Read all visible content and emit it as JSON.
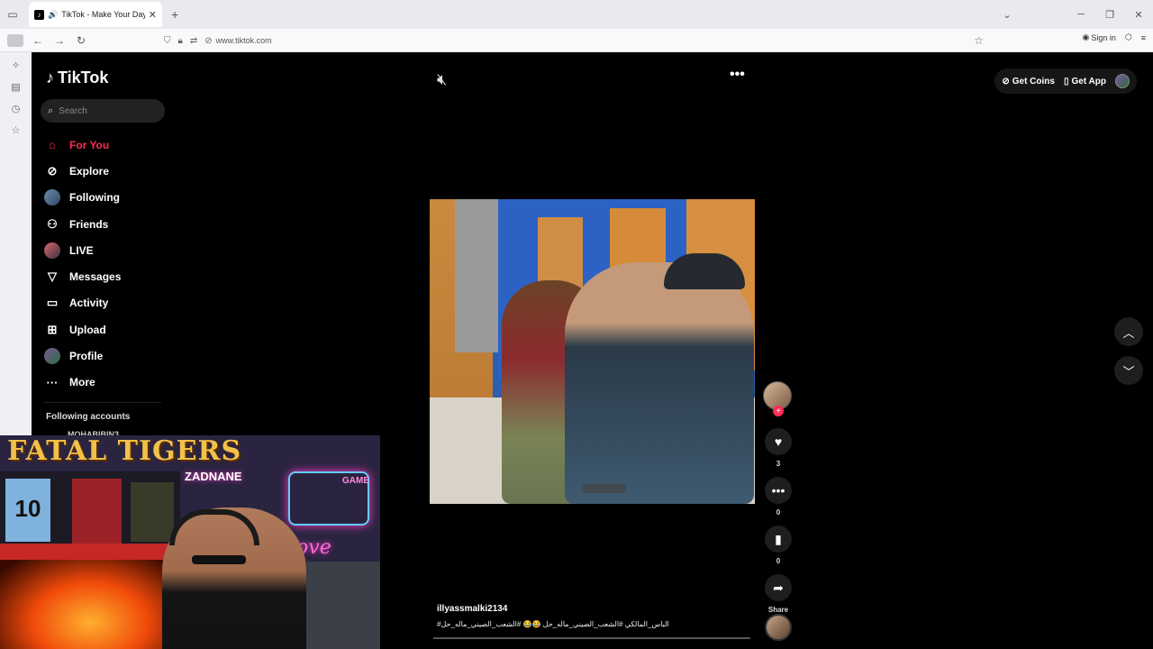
{
  "browser": {
    "tab_title": "TikTok - Make Your Day",
    "url": "www.tiktok.com",
    "sign_in": "Sign in"
  },
  "sidebar": {
    "logo": "TikTok",
    "search_placeholder": "Search",
    "items": [
      {
        "label": "For You",
        "icon": "home-icon"
      },
      {
        "label": "Explore",
        "icon": "compass-icon"
      },
      {
        "label": "Following",
        "icon": "avatar-icon"
      },
      {
        "label": "Friends",
        "icon": "friends-icon"
      },
      {
        "label": "LIVE",
        "icon": "live-icon"
      },
      {
        "label": "Messages",
        "icon": "send-icon"
      },
      {
        "label": "Activity",
        "icon": "activity-icon"
      },
      {
        "label": "Upload",
        "icon": "plus-square-icon"
      },
      {
        "label": "Profile",
        "icon": "profile-avatar-icon"
      },
      {
        "label": "More",
        "icon": "more-dots-icon"
      }
    ],
    "following_title": "Following accounts",
    "following_partial": "MOHABIBIN3"
  },
  "topbar": {
    "get_coins": "Get Coins",
    "get_app": "Get App"
  },
  "video": {
    "username": "illyassmalki2134",
    "hashtags": "#الباس_المالكي #الشعب_الصيني_ماله_حل 😂😂 #الشعب_الصيني_ماله_حل",
    "likes": "3",
    "comments": "0",
    "saves": "0",
    "share_label": "Share"
  },
  "webcam": {
    "banner": "FATAL TIGERS",
    "name_sign": "ZADNANE",
    "jersey_number": "10",
    "neon_text": "love",
    "game_text": "GAME"
  },
  "colors": {
    "accent": "#fe2c55",
    "background": "#000000"
  }
}
